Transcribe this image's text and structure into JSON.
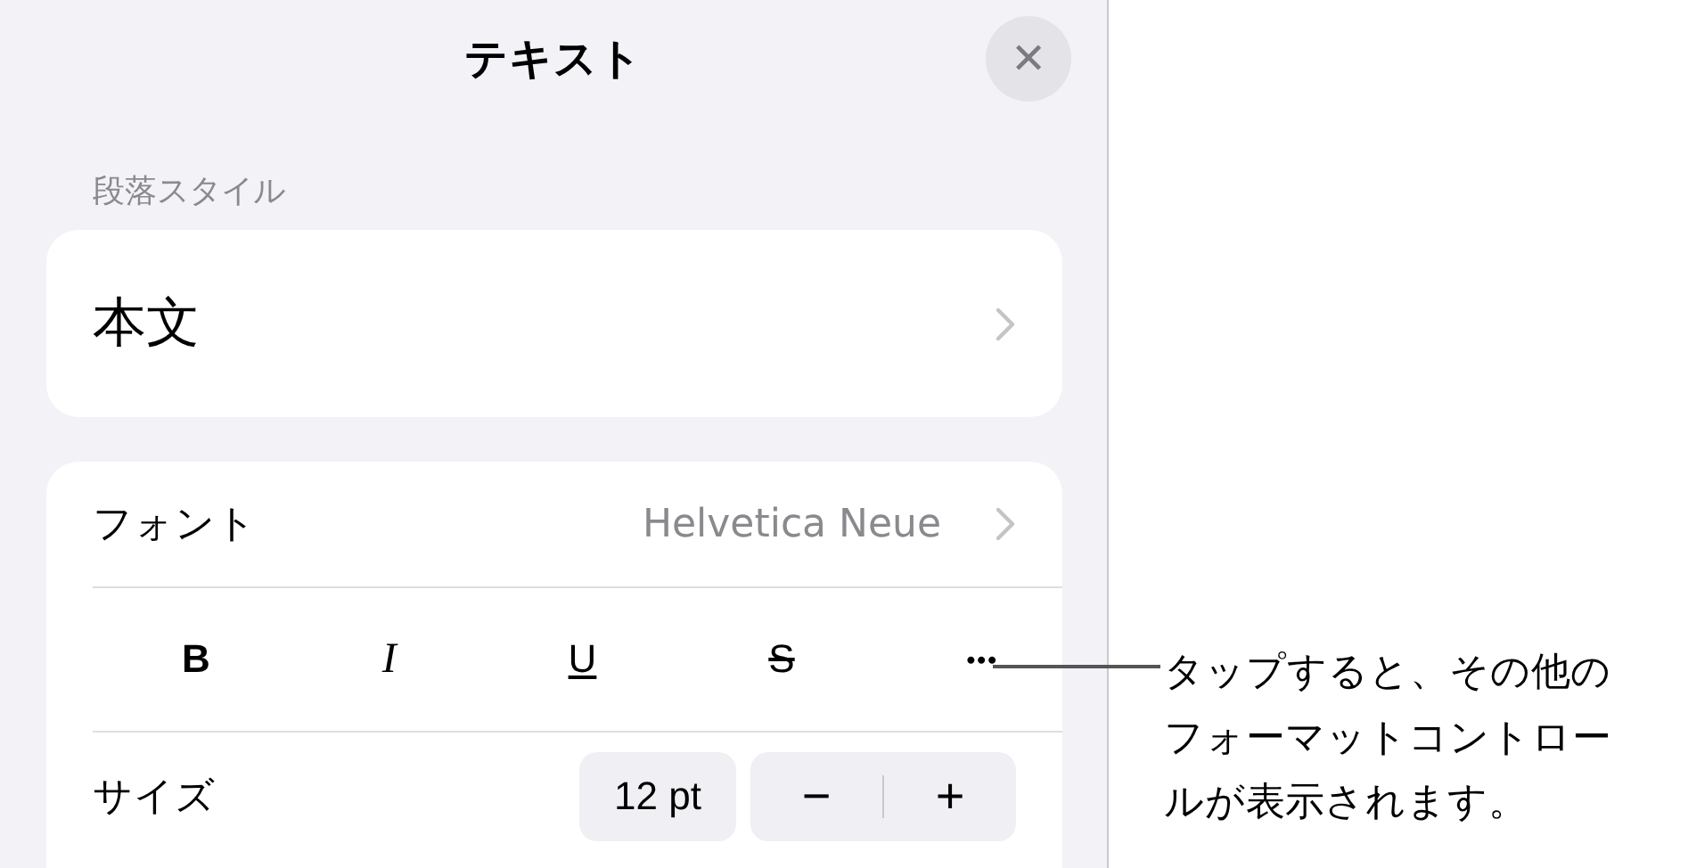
{
  "panel": {
    "title": "テキスト",
    "close": "✕",
    "paragraph_style": {
      "label": "段落スタイル",
      "value": "本文"
    },
    "font": {
      "label": "フォント",
      "value": "Helvetica Neue"
    },
    "format_buttons": [
      {
        "kind": "bold",
        "label": "B"
      },
      {
        "kind": "italic",
        "label": "I"
      },
      {
        "kind": "underline",
        "label": "U"
      },
      {
        "kind": "strike",
        "label": "S"
      },
      {
        "kind": "more",
        "label": "•••"
      }
    ],
    "size": {
      "label": "サイズ",
      "value": "12 pt",
      "minus": "−",
      "plus": "+"
    }
  },
  "callout": {
    "lines": [
      "タップすると、その他の",
      "フォーマットコントロー",
      "ルが表示されます。"
    ]
  }
}
